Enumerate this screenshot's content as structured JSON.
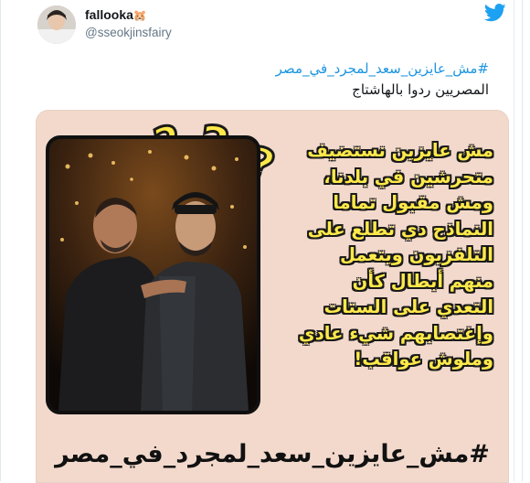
{
  "user": {
    "display_name": "fallooka",
    "name_emoji": "🐹",
    "handle": "@sseokjinsfairy"
  },
  "tweet": {
    "hashtag": "#مش_عايزين_سعد_لمجرد_في_مصر",
    "text": "المصريين ردوا بالهاشتاج"
  },
  "image": {
    "lines": [
      "مش عايزين نستضيف",
      "متحرشين في بلدنا،",
      "ومش مقبول تماما",
      "النماذج دي تطلع على",
      "التلفزيون ويتعمل",
      "منهم أبطال كأن",
      "التعدي على الستات",
      "وإغتصابهم شيء عادي",
      "وملوش عواقب!"
    ],
    "hashtag": "#مش_عايزين_سعد_لمجرد_في_مصر"
  },
  "colors": {
    "twitter_blue": "#1da1f2",
    "hashtag_blue": "#1b95e0",
    "image_bg": "#f2d9cc",
    "overlay_text": "#ffe94a"
  },
  "icons": {
    "brand": "twitter-bird-icon",
    "decor": "question-marks-icon"
  }
}
